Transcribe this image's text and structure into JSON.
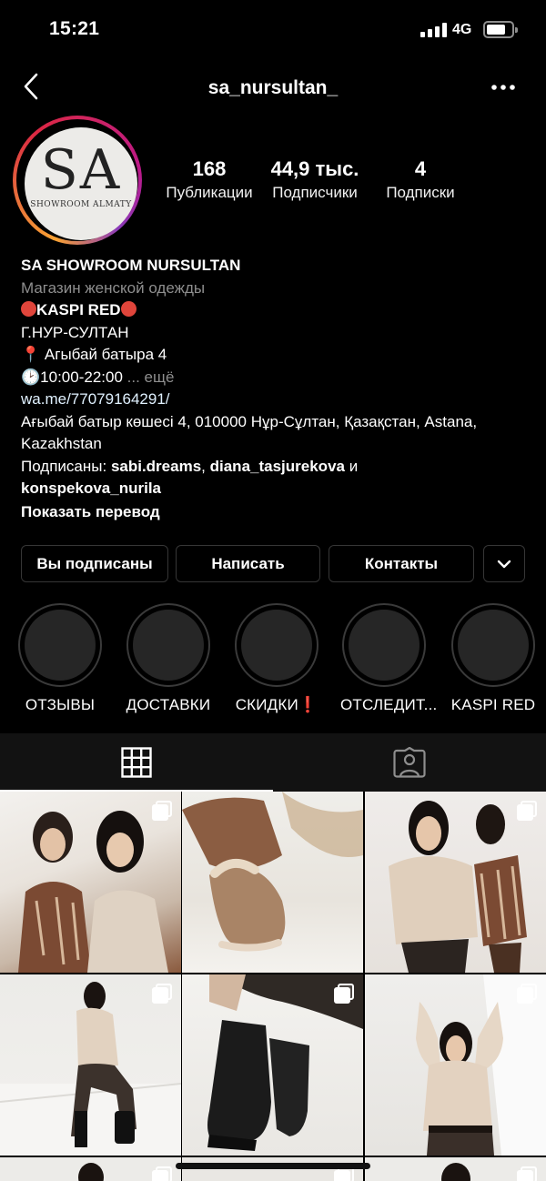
{
  "status": {
    "time": "15:21",
    "network": "4G"
  },
  "header": {
    "username": "sa_nursultan_"
  },
  "avatar": {
    "monogram": "SA",
    "subtext": "SHOWROOM ALMATY"
  },
  "stats": [
    {
      "value": "168",
      "label": "Публикации"
    },
    {
      "value": "44,9 тыс.",
      "label": "Подписчики"
    },
    {
      "value": "4",
      "label": "Подписки"
    }
  ],
  "bio": {
    "name": "SA SHOWROOM NURSULTAN",
    "category": "Магазин женской одежды",
    "line1": "KASPI RED",
    "line2": "Г.НУР-СУЛТАН",
    "line3": "Агыбай батыра 4",
    "line4": "10:00-22:00",
    "more": "... ещё",
    "link": "wa.me/77079164291/",
    "address": "Ағыбай батыр көшесі 4, 010000 Нұр-Сұлтан, Қазақстан, Astana, Kazakhstan",
    "followed_prefix": "Подписаны: ",
    "followed_1": "sabi.dreams",
    "followed_sep": ", ",
    "followed_2": "diana_tasjurekova",
    "followed_and": " и",
    "followed_3": "konspekova_nurila",
    "translate": "Показать перевод"
  },
  "buttons": {
    "following": "Вы подписаны",
    "message": "Написать",
    "contacts": "Контакты"
  },
  "highlights": [
    {
      "label": "ОТЗЫВЫ"
    },
    {
      "label": "ДОСТАВКИ"
    },
    {
      "label": "СКИДКИ❗"
    },
    {
      "label": "ОТСЛЕДИТ..."
    },
    {
      "label": "KASPI RED"
    }
  ],
  "icons": {
    "back": "chevron-left-icon",
    "more": "ellipsis-icon",
    "grid": "grid-icon",
    "tagged": "tagged-person-icon",
    "multi": "carousel-icon"
  }
}
